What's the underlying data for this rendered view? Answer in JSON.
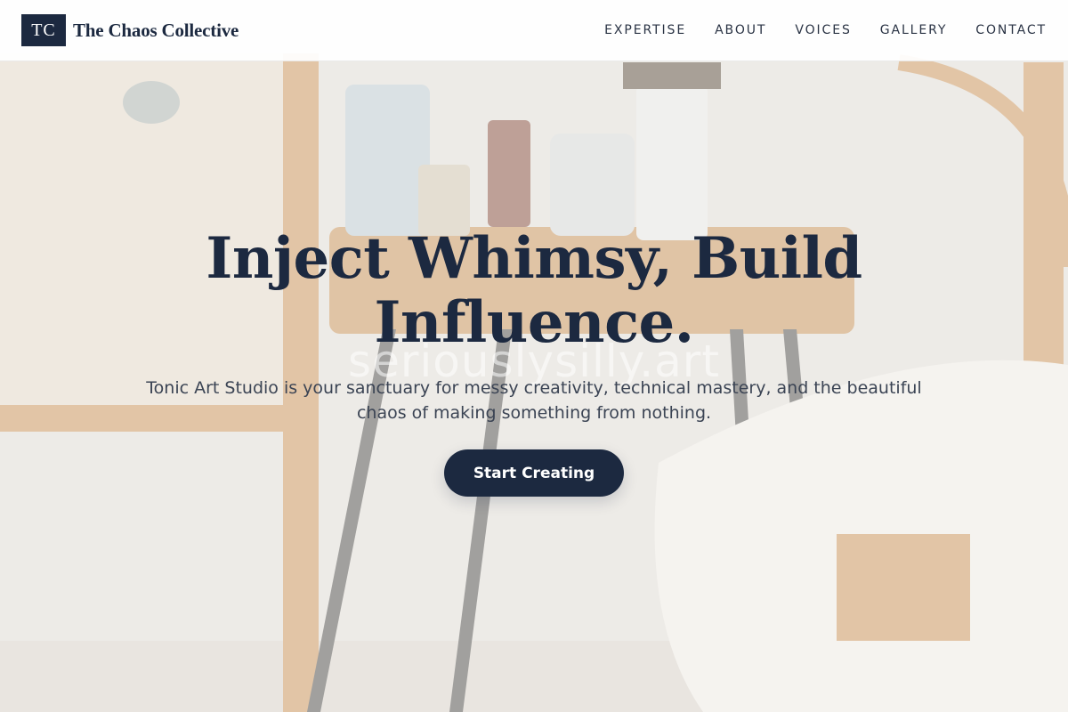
{
  "brand": {
    "monogram": "TC",
    "name": "The Chaos Collective"
  },
  "nav": {
    "items": [
      {
        "label": "EXPERTISE"
      },
      {
        "label": "ABOUT"
      },
      {
        "label": "VOICES"
      },
      {
        "label": "GALLERY"
      },
      {
        "label": "CONTACT"
      }
    ]
  },
  "hero": {
    "title": "Inject Whimsy, Build Influence.",
    "subtitle": "Tonic Art Studio is your sanctuary for messy creativity, technical mastery, and the beautiful chaos of making something from nothing.",
    "cta_label": "Start Creating",
    "watermark": "seriouslysilly.art"
  },
  "colors": {
    "navy": "#1c2940",
    "header_bg": "#ffffff",
    "wood": "#c98d4c"
  }
}
